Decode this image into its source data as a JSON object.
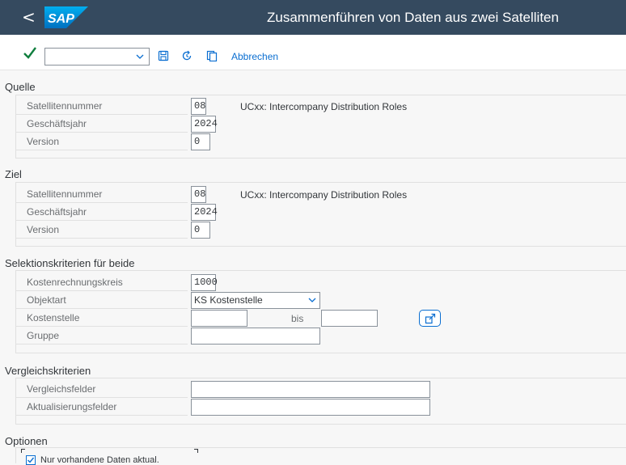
{
  "shell": {
    "back_label": "<",
    "logo_text": "SAP",
    "title": "Zusammenführen von Daten aus zwei Satelliten"
  },
  "toolbar": {
    "check_icon": "check-icon",
    "command_field_value": "",
    "save_icon": "save-icon",
    "refresh_icon": "refresh-icon",
    "copy_icon": "copy-icon",
    "cancel_label": "Abbrechen"
  },
  "source": {
    "title": "Quelle",
    "satellite_label": "Satellitennummer",
    "satellite_value": "08",
    "satellite_desc": "UCxx: Intercompany Distribution Roles",
    "year_label": "Geschäftsjahr",
    "year_value": "2024",
    "version_label": "Version",
    "version_value": "0"
  },
  "target": {
    "title": "Ziel",
    "satellite_label": "Satellitennummer",
    "satellite_value": "08",
    "satellite_desc": "UCxx: Intercompany Distribution Roles",
    "year_label": "Geschäftsjahr",
    "year_value": "2024",
    "version_label": "Version",
    "version_value": "0"
  },
  "selection": {
    "title": "Selektionskriterien für beide",
    "controlling_area_label": "Kostenrechnungskreis",
    "controlling_area_value": "1000",
    "object_type_label": "Objektart",
    "object_type_value": "KS Kostenstelle",
    "cost_center_label": "Kostenstelle",
    "cost_center_from": "",
    "bis_label": "bis",
    "cost_center_to": "",
    "group_label": "Gruppe",
    "group_value": ""
  },
  "comparison": {
    "title": "Vergleichskriterien",
    "compare_fields_label": "Vergleichsfelder",
    "compare_fields_value": "",
    "update_fields_label": "Aktualisierungsfelder",
    "update_fields_value": ""
  },
  "options": {
    "title": "Optionen",
    "only_existing_label": "Nur vorhandene Daten aktual.",
    "only_existing_checked": true
  },
  "colors": {
    "shell_bg": "#354a5f",
    "accent": "#0a6ed1",
    "check_green": "#107e3e"
  }
}
